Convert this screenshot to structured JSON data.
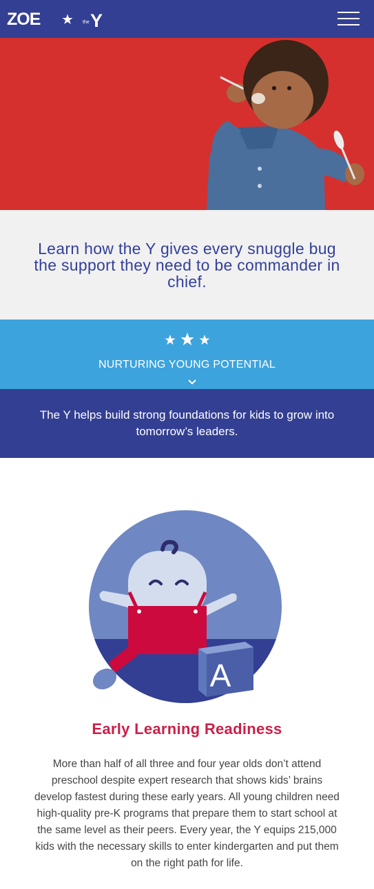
{
  "header": {
    "logo_zoe": "ZOE",
    "logo_y_prefix": "the",
    "logo_y_letter": "Y",
    "menu_icon": "hamburger-menu-icon",
    "background_color": "#333f92"
  },
  "hero": {
    "background_color": "#d5302e",
    "image": "toddler-eating-with-spoons-photo"
  },
  "intro": {
    "text": "Learn how the Y gives every snuggle bug the support they need to be commander in chief."
  },
  "banner": {
    "icon": "three-stars-icon",
    "title": "NURTURING YOUNG POTENTIAL",
    "expand_icon": "chevron-down-icon",
    "background_color": "#3da3dc"
  },
  "tagline": {
    "text": "The Y helps build strong foundations for kids to grow into tomorrow’s leaders."
  },
  "early_learning": {
    "illustration": "baby-with-letter-block-illustration",
    "block_letter": "A",
    "title": "Early Learning Readiness",
    "body": "More than half of all three and four year olds don’t attend preschool despite expert research that shows kids’ brains develop fastest during these early years. All young children need high-quality pre-K programs that prepare them to start school at the same level as their peers. Every year, the Y equips 215,000 kids with the necessary skills to enter kindergarten and put them on the right path for life.",
    "title_color": "#cc1f48"
  }
}
